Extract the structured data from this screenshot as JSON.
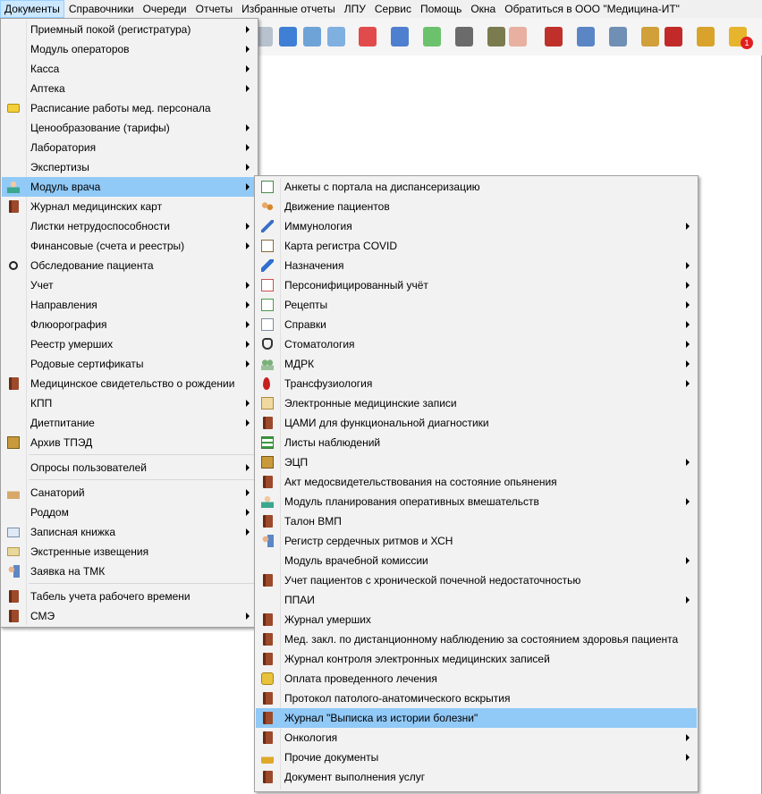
{
  "menubar": [
    {
      "label": "Документы",
      "active": true
    },
    {
      "label": "Справочники",
      "active": false
    },
    {
      "label": "Очереди",
      "active": false
    },
    {
      "label": "Отчеты",
      "active": false
    },
    {
      "label": "Избранные отчеты",
      "active": false
    },
    {
      "label": "ЛПУ",
      "active": false
    },
    {
      "label": "Сервис",
      "active": false
    },
    {
      "label": "Помощь",
      "active": false
    },
    {
      "label": "Окна",
      "active": false
    },
    {
      "label": "Обратиться в ООО \"Медицина-ИТ\"",
      "active": false
    }
  ],
  "toolbar_badge": "1",
  "colors": {
    "highlight": "#91c9f7",
    "menubar_active": "#cce8ff"
  },
  "main_menu": [
    {
      "label": "Приемный покой (регистратура)",
      "submenu": true,
      "icon": "none"
    },
    {
      "label": "Модуль операторов",
      "submenu": true,
      "icon": "none"
    },
    {
      "label": "Касса",
      "submenu": true,
      "icon": "none"
    },
    {
      "label": "Аптека",
      "submenu": true,
      "icon": "none"
    },
    {
      "label": "Расписание работы мед. персонала",
      "submenu": false,
      "icon": "schedule-icon"
    },
    {
      "label": "Ценообразование (тарифы)",
      "submenu": true,
      "icon": "none"
    },
    {
      "label": "Лаборатория",
      "submenu": true,
      "icon": "none"
    },
    {
      "label": "Экспертизы",
      "submenu": true,
      "icon": "none"
    },
    {
      "label": "Модуль врача",
      "submenu": true,
      "icon": "doctor-icon",
      "selected": true
    },
    {
      "label": "Журнал медицинских карт",
      "submenu": false,
      "icon": "book-icon"
    },
    {
      "label": "Листки нетрудоспособности",
      "submenu": true,
      "icon": "none"
    },
    {
      "label": "Финансовые (счета и реестры)",
      "submenu": true,
      "icon": "none"
    },
    {
      "label": "Обследование пациента",
      "submenu": false,
      "icon": "search-icon"
    },
    {
      "label": "Учет",
      "submenu": true,
      "icon": "none"
    },
    {
      "label": "Направления",
      "submenu": true,
      "icon": "none"
    },
    {
      "label": "Флюорография",
      "submenu": true,
      "icon": "none"
    },
    {
      "label": "Реестр умерших",
      "submenu": true,
      "icon": "none"
    },
    {
      "label": "Родовые сертификаты",
      "submenu": true,
      "icon": "none"
    },
    {
      "label": "Медицинское свидетельство о рождении",
      "submenu": false,
      "icon": "book-icon"
    },
    {
      "label": "КПП",
      "submenu": true,
      "icon": "none"
    },
    {
      "label": "Диетпитание",
      "submenu": true,
      "icon": "none"
    },
    {
      "label": "Архив ТПЭД",
      "submenu": false,
      "icon": "archive-icon"
    },
    {
      "separator": true
    },
    {
      "label": "Опросы пользователей",
      "submenu": true,
      "icon": "none"
    },
    {
      "separator": true
    },
    {
      "label": "Санаторий",
      "submenu": true,
      "icon": "house-icon"
    },
    {
      "label": "Роддом",
      "submenu": true,
      "icon": "none"
    },
    {
      "label": "Записная книжка",
      "submenu": true,
      "icon": "notebook-icon"
    },
    {
      "label": "Экстренные извещения",
      "submenu": false,
      "icon": "notice-icon"
    },
    {
      "label": "Заявка на ТМК",
      "submenu": false,
      "icon": "user-pc-icon"
    },
    {
      "separator": true
    },
    {
      "label": "Табель учета рабочего времени",
      "submenu": false,
      "icon": "book-icon"
    },
    {
      "label": "СМЭ",
      "submenu": true,
      "icon": "book-icon"
    }
  ],
  "sub_menu": [
    {
      "label": "Анкеты с портала на диспансеризацию",
      "submenu": false,
      "icon": "checklist-icon"
    },
    {
      "label": "Движение пациентов",
      "submenu": false,
      "icon": "patients-icon"
    },
    {
      "label": "Иммунология",
      "submenu": true,
      "icon": "syringe-icon"
    },
    {
      "label": "Карта регистра COVID",
      "submenu": false,
      "icon": "clipboard-icon"
    },
    {
      "label": "Назначения",
      "submenu": true,
      "icon": "pen-icon"
    },
    {
      "label": "Персонифицированный учёт",
      "submenu": true,
      "icon": "medical-doc-icon"
    },
    {
      "label": "Рецепты",
      "submenu": true,
      "icon": "prescription-icon"
    },
    {
      "label": "Справки",
      "submenu": true,
      "icon": "document-icon"
    },
    {
      "label": "Стоматология",
      "submenu": true,
      "icon": "tooth-icon"
    },
    {
      "label": "МДРК",
      "submenu": true,
      "icon": "team-icon"
    },
    {
      "label": "Трансфузиология",
      "submenu": true,
      "icon": "blood-drop-icon"
    },
    {
      "label": "Электронные медицинские записи",
      "submenu": false,
      "icon": "notepad-icon"
    },
    {
      "label": "ЦАМИ для функциональной диагностики",
      "submenu": false,
      "icon": "book-icon"
    },
    {
      "label": "Листы наблюдений",
      "submenu": false,
      "icon": "list-icon"
    },
    {
      "label": "ЭЦП",
      "submenu": true,
      "icon": "archive-icon"
    },
    {
      "label": "Акт медосвидетельствования на состояние опьянения",
      "submenu": false,
      "icon": "book-icon"
    },
    {
      "label": "Модуль планирования оперативных вмешательств",
      "submenu": true,
      "icon": "doctor-icon"
    },
    {
      "label": "Талон ВМП",
      "submenu": false,
      "icon": "book-icon"
    },
    {
      "label": "Регистр сердечных ритмов и ХСН",
      "submenu": false,
      "icon": "user-pc-icon"
    },
    {
      "label": "Модуль врачебной комиссии",
      "submenu": true,
      "icon": "none"
    },
    {
      "label": "Учет пациентов с хронической почечной недостаточностью",
      "submenu": false,
      "icon": "book-icon"
    },
    {
      "label": "ППАИ",
      "submenu": true,
      "icon": "none"
    },
    {
      "label": "Журнал умерших",
      "submenu": false,
      "icon": "book-icon"
    },
    {
      "label": "Мед. закл. по дистанционному наблюдению за состоянием здоровья пациента",
      "submenu": false,
      "icon": "book-icon"
    },
    {
      "label": "Журнал контроля электронных медицинских записей",
      "submenu": false,
      "icon": "book-icon"
    },
    {
      "label": "Оплата проведенного лечения",
      "submenu": false,
      "icon": "coins-icon"
    },
    {
      "label": "Протокол патолого-анатомического вскрытия",
      "submenu": false,
      "icon": "book-icon"
    },
    {
      "label": "Журнал \"Выписка из истории болезни\"",
      "submenu": false,
      "icon": "book-icon",
      "selected": true
    },
    {
      "label": "Онкология",
      "submenu": true,
      "icon": "book-icon"
    },
    {
      "label": "Прочие документы",
      "submenu": true,
      "icon": "lock-icon"
    },
    {
      "label": "Документ выполнения услуг",
      "submenu": false,
      "icon": "book-icon"
    }
  ]
}
